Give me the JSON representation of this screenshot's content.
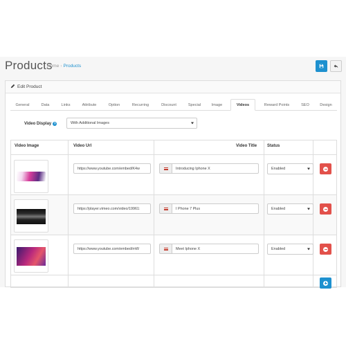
{
  "header": {
    "title": "Products",
    "breadcrumb": [
      {
        "label": "Home"
      },
      {
        "label": "Products"
      }
    ],
    "save_icon": "save-icon",
    "back_icon": "reply-icon"
  },
  "panel": {
    "title": "Edit Product",
    "icon": "pencil-icon"
  },
  "tabs": [
    {
      "label": "General"
    },
    {
      "label": "Data"
    },
    {
      "label": "Links"
    },
    {
      "label": "Attribute"
    },
    {
      "label": "Option"
    },
    {
      "label": "Recurring"
    },
    {
      "label": "Discount"
    },
    {
      "label": "Special"
    },
    {
      "label": "Image"
    },
    {
      "label": "Videos",
      "active": true
    },
    {
      "label": "Reward Points"
    },
    {
      "label": "SEO"
    },
    {
      "label": "Design"
    }
  ],
  "video_display": {
    "label": "Video Display",
    "value": "With Additional Images"
  },
  "table": {
    "headers": {
      "image": "Video Image",
      "url": "Video Url",
      "title": "Video Title",
      "status": "Status"
    },
    "rows": [
      {
        "url": "https://www.youtube.com/embed/K4w",
        "title": "Introducing Iphone X",
        "status": "Enabled"
      },
      {
        "url": "https://player.vimeo.com/video/19961:",
        "title": "I Phone 7 Plus",
        "status": "Enabled"
      },
      {
        "url": "https://www.youtube.com/embed/mW",
        "title": "Meet Iphone X",
        "status": "Enabled"
      }
    ]
  },
  "colors": {
    "primary": "#1e91cf",
    "danger": "#e2514b"
  }
}
